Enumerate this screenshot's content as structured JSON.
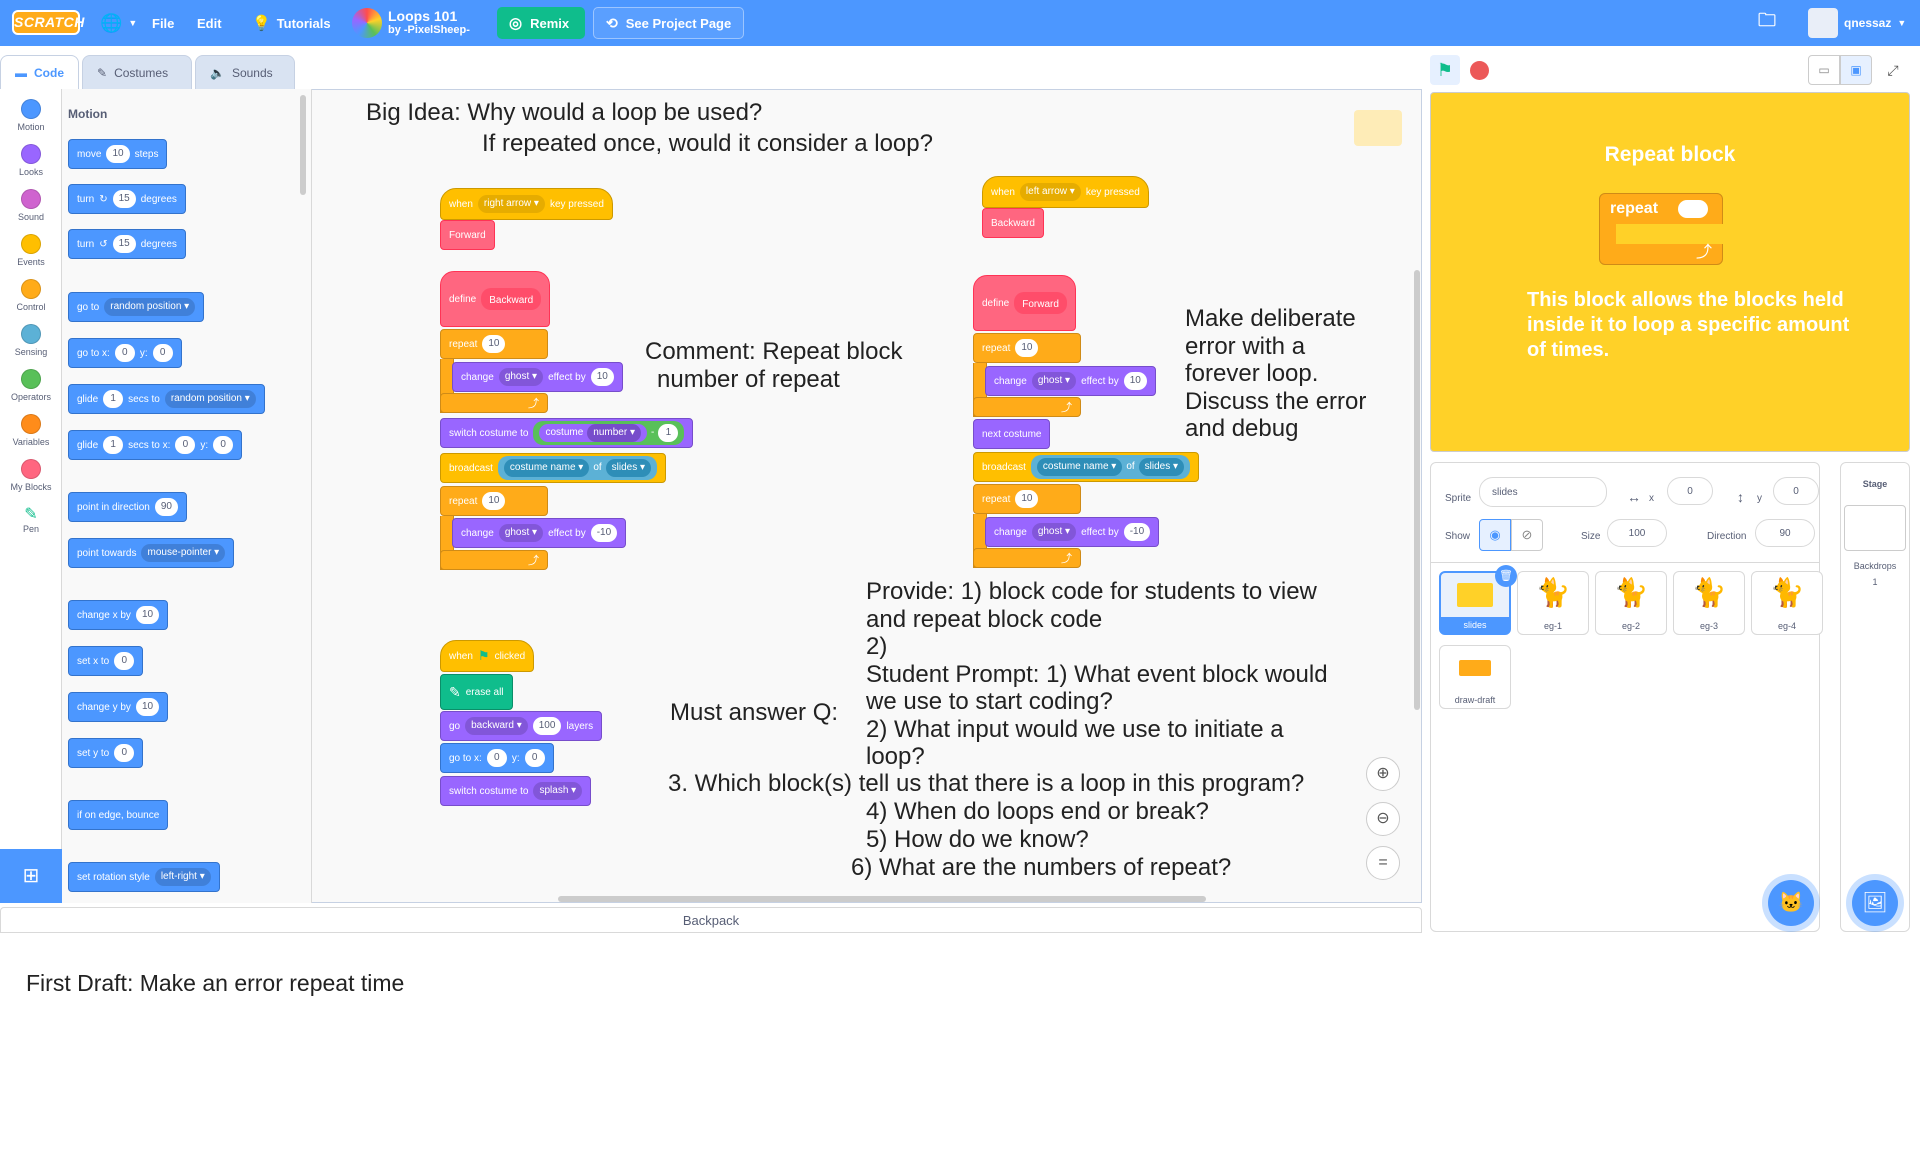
{
  "menubar": {
    "logo": "SCRATCH",
    "file": "File",
    "edit": "Edit",
    "tutorials": "Tutorials",
    "project_title": "Loops 101",
    "author": "by -PixelSheep-",
    "remix": "Remix",
    "see_project_page": "See Project Page",
    "username": "qnessaz",
    "colors": {
      "bar": "#4c97ff",
      "remix": "#0fbd8c"
    }
  },
  "tabs": [
    {
      "label": "Code",
      "icon": "code-icon",
      "active": true
    },
    {
      "label": "Costumes",
      "icon": "brush-icon",
      "active": false
    },
    {
      "label": "Sounds",
      "icon": "speaker-icon",
      "active": false
    }
  ],
  "categories": [
    {
      "label": "Motion",
      "color": "#4c97ff"
    },
    {
      "label": "Looks",
      "color": "#9966ff"
    },
    {
      "label": "Sound",
      "color": "#cf63cf"
    },
    {
      "label": "Events",
      "color": "#ffbf00"
    },
    {
      "label": "Control",
      "color": "#ffab19"
    },
    {
      "label": "Sensing",
      "color": "#5cb1d6"
    },
    {
      "label": "Operators",
      "color": "#59c059"
    },
    {
      "label": "Variables",
      "color": "#ff8c1a"
    },
    {
      "label": "My Blocks",
      "color": "#ff6680"
    },
    {
      "label": "Pen",
      "color": "#0fbd8c"
    }
  ],
  "palette": {
    "heading": "Motion",
    "move": "move",
    "move_n": "10",
    "steps": "steps",
    "turn": "turn",
    "turn_n": "15",
    "degrees": "degrees",
    "goto": "go to",
    "random_position": "random position",
    "gotoxy": "go to x:",
    "x0": "0",
    "y_lbl": "y:",
    "y0": "0",
    "glide": "glide",
    "glide_n": "1",
    "secs_to": "secs to",
    "secs_to_x": "secs to x:",
    "point_dir": "point in direction",
    "dir_n": "90",
    "point_towards": "point towards",
    "mouse_pointer": "mouse-pointer",
    "change_x": "change x by",
    "cx_n": "10",
    "set_x": "set x to",
    "sx_n": "0",
    "change_y": "change y by",
    "cy_n": "10",
    "set_y": "set y to",
    "sy_n": "0",
    "edge_bounce": "if on edge, bounce",
    "rot_style": "set rotation style",
    "left_right": "left-right"
  },
  "canvas": {
    "big_idea_1": "Big Idea:  Why would a loop be used?",
    "big_idea_2": "If repeated once, would it consider a loop?",
    "comment": "Comment: Repeat block",
    "comment2": "number of repeat",
    "deliberate": [
      "Make deliberate",
      "error with a",
      "forever loop.",
      "Discuss the error",
      "and debug"
    ],
    "provide": [
      "Provide: 1) block code for students to view",
      "and repeat block code",
      "2)",
      "Student Prompt: 1) What event block would",
      "we use to start coding?",
      "2) What input would we use to initiate a",
      "loop?"
    ],
    "must_answer": "Must answer Q:",
    "q3": "3. Which block(s) tell us that there is a loop in this program?",
    "q4": "4) When do loops end or break?",
    "q5": "5) How do we know?",
    "q6": "6) What are the numbers of repeat?",
    "when": "when",
    "right_arrow": "right arrow",
    "left_arrow": "left arrow",
    "key_pressed": "key pressed",
    "forward": "Forward",
    "backward": "Backward",
    "define": "define",
    "repeat": "repeat",
    "ten": "10",
    "change": "change",
    "ghost": "ghost",
    "effect_by": "effect by",
    "neg10": "-10",
    "switch_costume": "switch costume to",
    "costume": "costume",
    "number": "number",
    "minus": "-",
    "one": "1",
    "broadcast": "broadcast",
    "costume_name": "costume name",
    "of": "of",
    "slides": "slides",
    "next_costume": "next costume",
    "clicked": "clicked",
    "erase_all": "erase all",
    "go": "go",
    "backward_dd": "backward",
    "hundred": "100",
    "layers": "layers",
    "goto_x": "go to x:",
    "zero": "0",
    "y": "y:",
    "splash": "splash"
  },
  "stage": {
    "title": "Repeat block",
    "repeat_label": "repeat",
    "body": "This block allows the blocks held inside it to loop a specific amount of times.",
    "bg_color": "#ffd128"
  },
  "sprite_info": {
    "sprite_lbl": "Sprite",
    "sprite_name": "slides",
    "x_lbl": "x",
    "x_val": "0",
    "y_lbl": "y",
    "y_val": "0",
    "show_lbl": "Show",
    "size_lbl": "Size",
    "size_val": "100",
    "direction_lbl": "Direction",
    "direction_val": "90"
  },
  "sprites": [
    "slides",
    "eg-1",
    "eg-2",
    "eg-3",
    "eg-4",
    "draw-draft"
  ],
  "stage_pane": {
    "title": "Stage",
    "backdrops_lbl": "Backdrops",
    "backdrops_n": "1"
  },
  "backpack": "Backpack",
  "first_draft": "First Draft:  Make an error repeat time"
}
